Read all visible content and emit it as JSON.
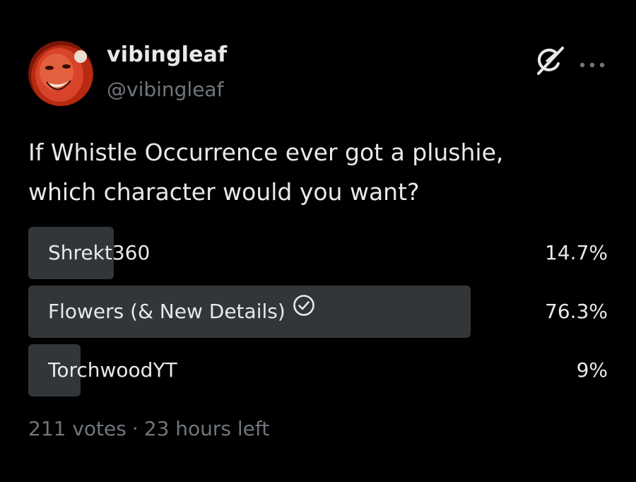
{
  "author": {
    "display_name": "vibingleaf",
    "handle": "@vibingleaf"
  },
  "icons": {
    "grok": "grok-icon",
    "more": "more-options-icon",
    "check": "check-circle-icon"
  },
  "tweet": {
    "text_lines": [
      "If Whistle Occurrence ever got a plushie,",
      "which character would you want?"
    ]
  },
  "poll": {
    "options": [
      {
        "label": "Shrekt360",
        "percent_text": "14.7%",
        "percent": 14.7,
        "winner": false
      },
      {
        "label": "Flowers (& New Details)",
        "percent_text": "76.3%",
        "percent": 76.3,
        "winner": true
      },
      {
        "label": "TorchwoodYT",
        "percent_text": "9%",
        "percent": 9,
        "winner": false
      }
    ],
    "votes_text": "211 votes",
    "separator": "·",
    "time_left_text": "23 hours left"
  },
  "colors": {
    "background": "#000000",
    "text_primary": "#e7e9ea",
    "text_secondary": "#71767b",
    "bar_fill": "#333639"
  }
}
